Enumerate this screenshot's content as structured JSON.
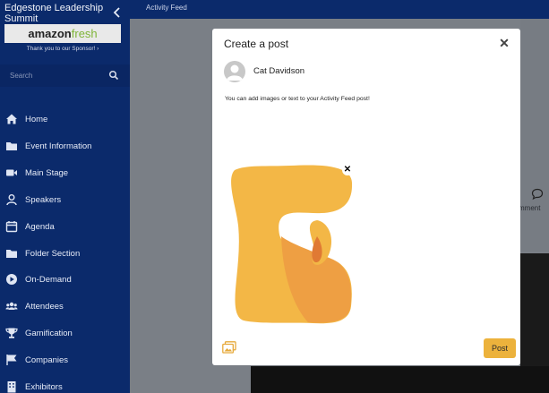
{
  "sidebar": {
    "event_name": "Edgestone Leadership Summit",
    "sponsor_logo_a": "amazon",
    "sponsor_logo_b": "fresh",
    "sponsor_caption": "Thank you to our Sponsor! ›",
    "search_placeholder": "Search",
    "items": [
      {
        "label": "Home",
        "icon": "home-icon"
      },
      {
        "label": "Event Information",
        "icon": "folder-icon"
      },
      {
        "label": "Main Stage",
        "icon": "video-icon"
      },
      {
        "label": "Speakers",
        "icon": "person-icon"
      },
      {
        "label": "Agenda",
        "icon": "calendar-icon"
      },
      {
        "label": "Folder Section",
        "icon": "folder-icon"
      },
      {
        "label": "On-Demand",
        "icon": "play-circle-icon"
      },
      {
        "label": "Attendees",
        "icon": "users-icon"
      },
      {
        "label": "Gamification",
        "icon": "trophy-icon"
      },
      {
        "label": "Companies",
        "icon": "flag-icon"
      },
      {
        "label": "Exhibitors",
        "icon": "building-icon"
      }
    ]
  },
  "topbar": {
    "title": "Activity Feed"
  },
  "feed": {
    "comment_label": "mment"
  },
  "modal": {
    "title": "Create a post",
    "user_name": "Cat Davidson",
    "hint": "You can add images or text to your Activity Feed post!",
    "post_label": "Post"
  },
  "colors": {
    "sidebar_bg": "#0b2a6b",
    "post_button": "#ecb23c",
    "logo_yellow": "#f2b541",
    "logo_orange": "#e79a3f"
  }
}
